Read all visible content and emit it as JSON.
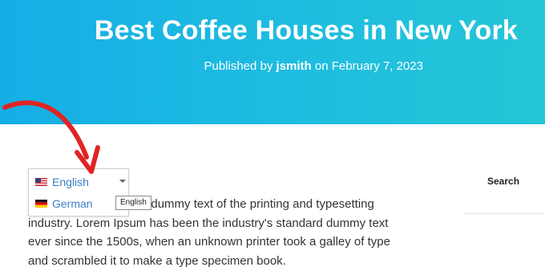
{
  "hero": {
    "title": "Best Coffee Houses in New York",
    "byline_prefix": "Published by ",
    "author": "jsmith",
    "byline_date": " on February 7, 2023",
    "gradient_start": "#15aee6",
    "gradient_end": "#25c6d6"
  },
  "content": {
    "paragraph": "Lorem Ipsum is simply dummy text of the printing and typesetting industry. Lorem Ipsum has been the industry's standard dummy text ever since the 1500s, when an unknown printer took a galley of type and scrambled it to make a type specimen book."
  },
  "sidebar": {
    "search_label": "Search"
  },
  "language_switcher": {
    "options": [
      {
        "label": "English",
        "flag": "us-flag-icon",
        "selected": true
      },
      {
        "label": "German",
        "flag": "de-flag-icon",
        "selected": false
      }
    ],
    "tooltip": "English",
    "link_color": "#3b7fc4"
  },
  "annotation": {
    "arrow_color": "#e02424"
  }
}
